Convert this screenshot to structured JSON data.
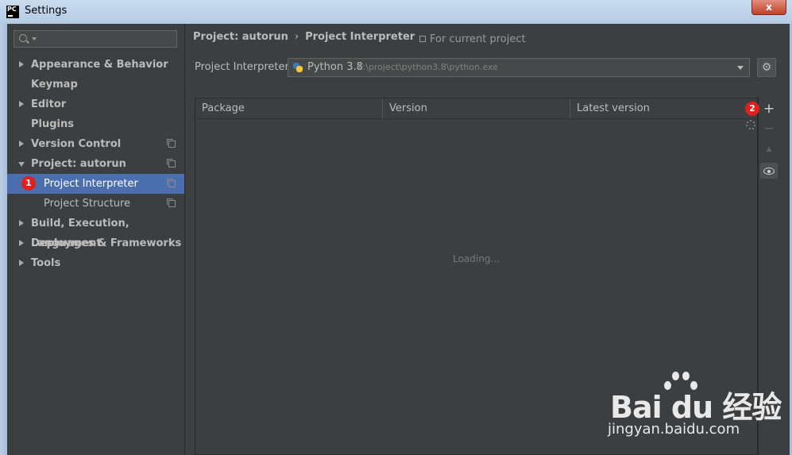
{
  "window": {
    "title": "Settings",
    "app_icon_text": "PC",
    "close_label": "x"
  },
  "sidebar": {
    "search_placeholder": "",
    "items": [
      {
        "label": "Appearance & Behavior",
        "expand": "collapsed",
        "bold": true
      },
      {
        "label": "Keymap",
        "expand": "none",
        "bold": true
      },
      {
        "label": "Editor",
        "expand": "collapsed",
        "bold": true
      },
      {
        "label": "Plugins",
        "expand": "none",
        "bold": true
      },
      {
        "label": "Version Control",
        "expand": "collapsed",
        "bold": true,
        "copy_icon": true
      },
      {
        "label": "Project: autorun",
        "expand": "expanded",
        "bold": true,
        "copy_icon": true
      },
      {
        "label": "Project Interpreter",
        "expand": "child",
        "selected": true,
        "copy_icon": true,
        "badge": "1"
      },
      {
        "label": "Project Structure",
        "expand": "child",
        "copy_icon": true
      },
      {
        "label": "Build, Execution, Deployment",
        "expand": "collapsed",
        "bold": true
      },
      {
        "label": "Languages & Frameworks",
        "expand": "collapsed",
        "bold": true
      },
      {
        "label": "Tools",
        "expand": "collapsed",
        "bold": true
      }
    ]
  },
  "main": {
    "breadcrumb": {
      "parent": "Project: autorun",
      "separator": "›",
      "current": "Project Interpreter"
    },
    "for_current_project": "For current project",
    "interpreter": {
      "label": "Project Interpreter:",
      "name": "Python 3.8",
      "path": "F:\\project\\python3.8\\python.exe"
    },
    "table": {
      "columns": [
        "Package",
        "Version",
        "Latest version"
      ],
      "loading_text": "Loading...",
      "rows": []
    },
    "toolbar": {
      "add_label": "+",
      "remove_label": "−",
      "upgrade_label": "▲",
      "badge": "2"
    }
  },
  "watermark": {
    "brand": "Bai du 经验",
    "url": "jingyan.baidu.com"
  },
  "colors": {
    "background": "#3c3f41",
    "selection": "#4b6eaf",
    "badge": "#e0201c",
    "text": "#bbbbbb"
  }
}
